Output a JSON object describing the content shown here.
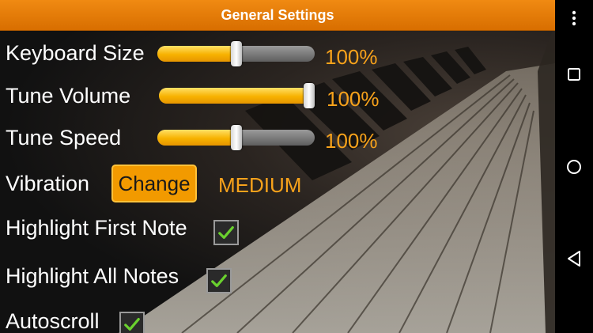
{
  "header": {
    "title": "General Settings"
  },
  "settings": {
    "keyboard_size": {
      "label": "Keyboard Size",
      "value_text": "100%",
      "level": 0.5
    },
    "tune_volume": {
      "label": "Tune Volume",
      "value_text": "100%",
      "level": 1.0
    },
    "tune_speed": {
      "label": "Tune Speed",
      "value_text": "100%",
      "level": 0.5
    },
    "vibration": {
      "label": "Vibration",
      "button_label": "Change",
      "value_text": "MEDIUM"
    },
    "highlight_first_note": {
      "label": "Highlight First Note",
      "checked": true
    },
    "highlight_all_notes": {
      "label": "Highlight All Notes",
      "checked": true
    },
    "autoscroll": {
      "label": "Autoscroll",
      "checked": true
    }
  },
  "nav": {
    "icons": [
      "more-vert-icon",
      "recents-square-icon",
      "home-circle-icon",
      "back-triangle-icon"
    ]
  },
  "colors": {
    "accent": "#f7a21b",
    "title_bar": "#e67e00",
    "check": "#6ad12e"
  }
}
